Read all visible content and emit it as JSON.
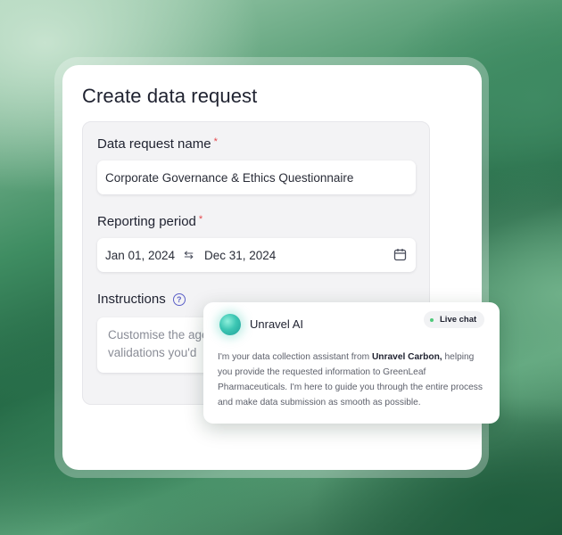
{
  "form": {
    "title": "Create data request",
    "name_label": "Data request name",
    "required_mark": "*",
    "name_value": "Corporate Governance & Ethics Questionnaire",
    "period_label": "Reporting period",
    "period_start": "Jan 01, 2024",
    "period_end": "Dec 31, 2024",
    "instructions_label": "Instructions",
    "instructions_placeholder_line1": "Customise the age",
    "instructions_placeholder_line2": "validations you'd"
  },
  "chat": {
    "name": "Unravel AI",
    "status": "Live chat",
    "message_before": "I'm your data collection assistant from ",
    "message_brand": "Unravel Carbon,",
    "message_after": " helping you provide the requested information to GreenLeaf Pharmaceuticals. I'm here to guide you through the entire process and make data submission as smooth as possible."
  },
  "colors": {
    "required": "#e5484d",
    "help_icon": "#5b5fc7",
    "live_dot": "#4ec97a"
  },
  "icons": [
    "swap-arrows-icon",
    "calendar-icon",
    "help-circle-icon",
    "ai-orb-icon"
  ]
}
